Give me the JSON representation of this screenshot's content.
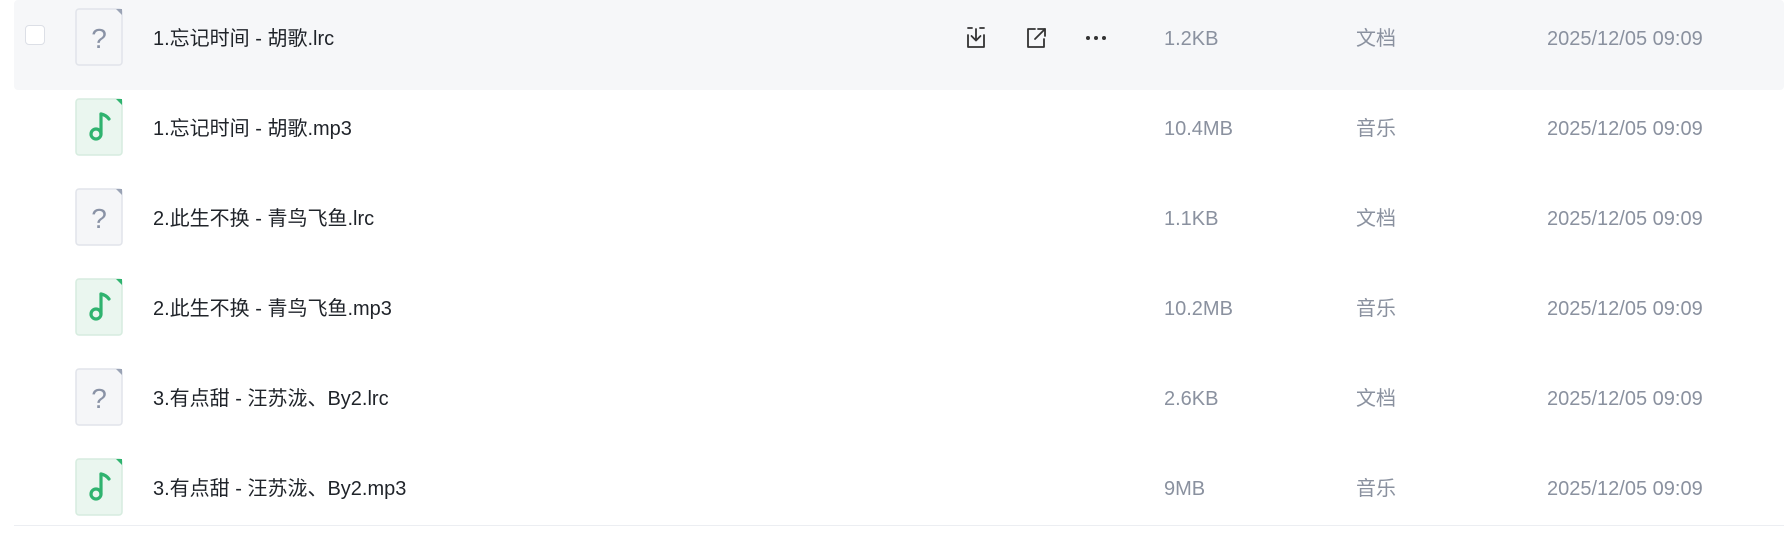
{
  "files": [
    {
      "name": "1.忘记时间 - 胡歌.lrc",
      "size": "1.2KB",
      "type": "文档",
      "date": "2025/12/05 09:09",
      "icon": "unknown-file-icon"
    },
    {
      "name": "1.忘记时间 - 胡歌.mp3",
      "size": "10.4MB",
      "type": "音乐",
      "date": "2025/12/05 09:09",
      "icon": "music-file-icon"
    },
    {
      "name": "2.此生不换 - 青鸟飞鱼.lrc",
      "size": "1.1KB",
      "type": "文档",
      "date": "2025/12/05 09:09",
      "icon": "unknown-file-icon"
    },
    {
      "name": "2.此生不换 - 青鸟飞鱼.mp3",
      "size": "10.2MB",
      "type": "音乐",
      "date": "2025/12/05 09:09",
      "icon": "music-file-icon"
    },
    {
      "name": "3.有点甜 - 汪苏泷、By2.lrc",
      "size": "2.6KB",
      "type": "文档",
      "date": "2025/12/05 09:09",
      "icon": "unknown-file-icon"
    },
    {
      "name": "3.有点甜 - 汪苏泷、By2.mp3",
      "size": "9MB",
      "type": "音乐",
      "date": "2025/12/05 09:09",
      "icon": "music-file-icon"
    }
  ],
  "hover_actions": [
    "download-icon",
    "share-icon",
    "more-icon"
  ],
  "colors": {
    "hover_bg": "#f6f7f9",
    "music_icon": "#2fb36f",
    "unknown_icon": "#8a93a6",
    "text_primary": "#1f2329",
    "text_secondary": "#8a919f"
  }
}
